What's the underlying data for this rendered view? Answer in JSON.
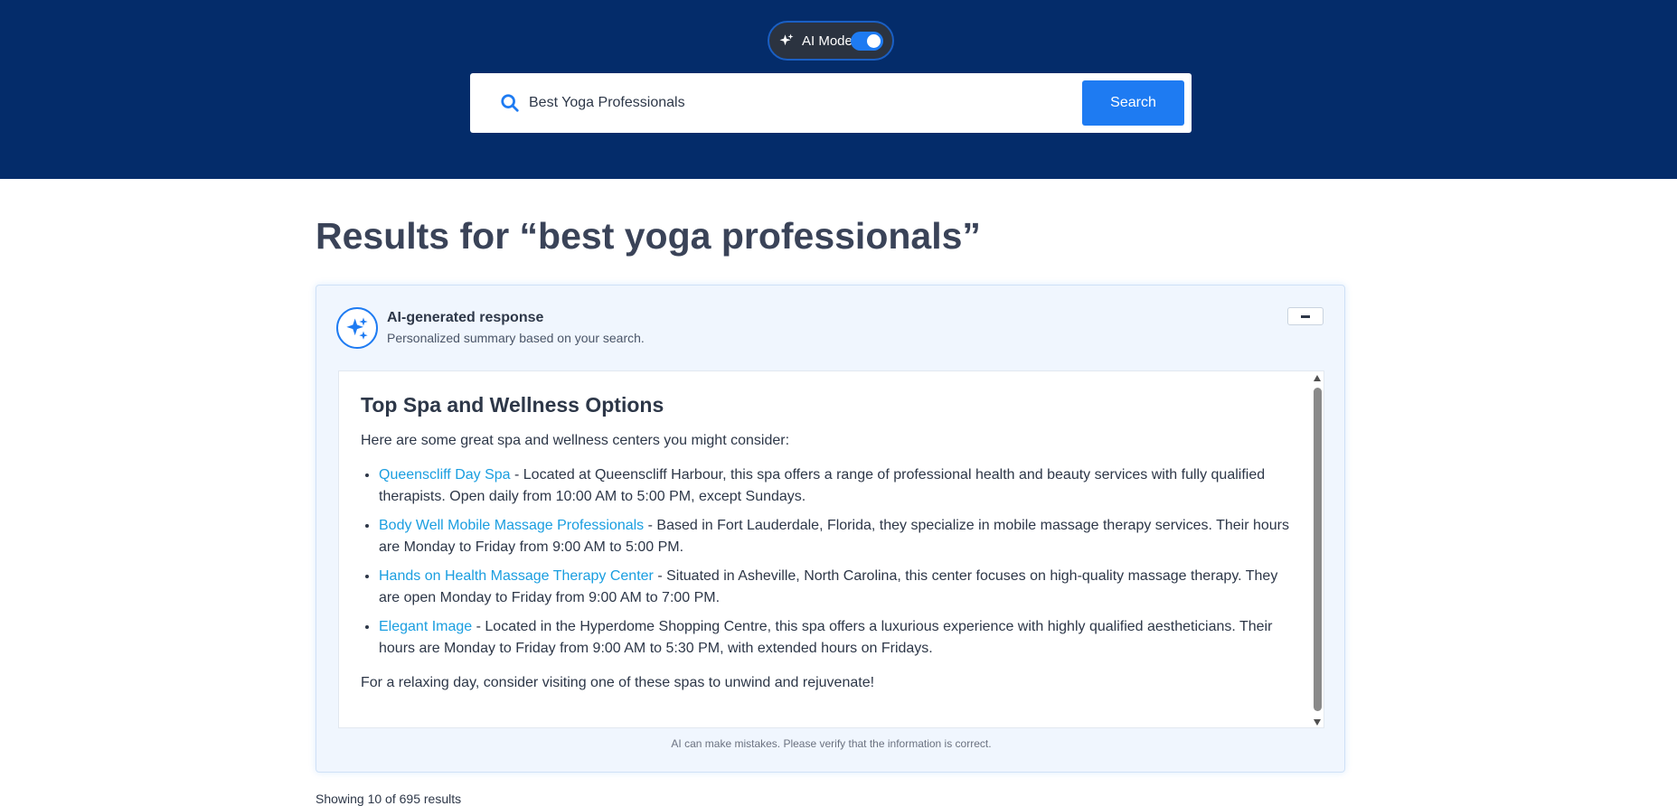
{
  "header": {
    "ai_mode_label": "AI Mode",
    "ai_mode_enabled": true,
    "search_value": "Best Yoga Professionals",
    "search_button_label": "Search"
  },
  "results": {
    "title": "Results for “best yoga professionals”",
    "showing_text": "Showing 10 of 695 results"
  },
  "ai_panel": {
    "heading": "AI-generated response",
    "subheading": "Personalized summary based on your search.",
    "content_title": "Top Spa and Wellness Options",
    "intro": "Here are some great spa and wellness centers you might consider:",
    "items": [
      {
        "link": "Queenscliff Day Spa",
        "text": " - Located at Queenscliff Harbour, this spa offers a range of professional health and beauty services with fully qualified therapists. Open daily from 10:00 AM to 5:00 PM, except Sundays."
      },
      {
        "link": "Body Well Mobile Massage Professionals",
        "text": " - Based in Fort Lauderdale, Florida, they specialize in mobile massage therapy services. Their hours are Monday to Friday from 9:00 AM to 5:00 PM."
      },
      {
        "link": "Hands on Health Massage Therapy Center",
        "text": " - Situated in Asheville, North Carolina, this center focuses on high-quality massage therapy. They are open Monday to Friday from 9:00 AM to 7:00 PM."
      },
      {
        "link": "Elegant Image",
        "text": " - Located in the Hyperdome Shopping Centre, this spa offers a luxurious experience with highly qualified aestheticians. Their hours are Monday to Friday from 9:00 AM to 5:30 PM, with extended hours on Fridays."
      }
    ],
    "closing": "For a relaxing day, consider visiting one of these spas to unwind and rejuvenate!",
    "disclaimer": "AI can make mistakes. Please verify that the information is correct."
  },
  "colors": {
    "header_bg": "#042c6a",
    "accent": "#1e7bf2",
    "link": "#1a9ee0",
    "panel_bg": "#f0f6fe"
  }
}
